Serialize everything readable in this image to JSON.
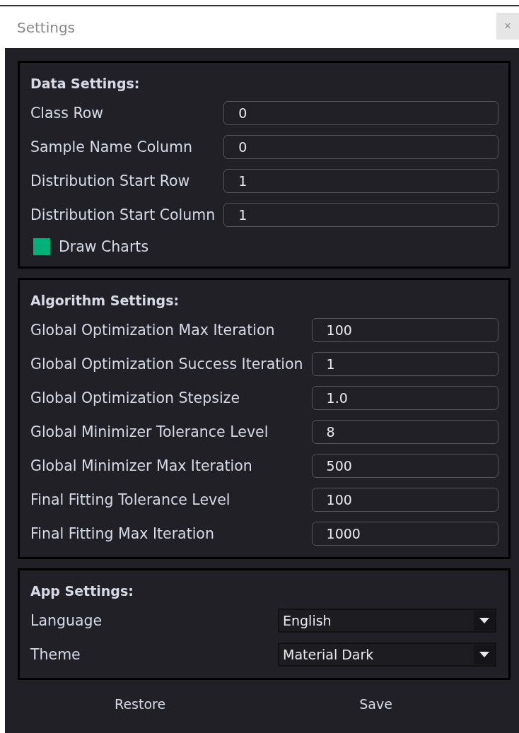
{
  "window": {
    "title": "Settings",
    "close": "×"
  },
  "sections": [
    {
      "title": "Data Settings:",
      "kind": "fields",
      "rows": [
        {
          "kind": "input",
          "label": "Class Row",
          "value": "0"
        },
        {
          "kind": "input",
          "label": "Sample Name Column",
          "value": "0"
        },
        {
          "kind": "input",
          "label": "Distribution Start Row",
          "value": "1"
        },
        {
          "kind": "input",
          "label": "Distribution Start Column",
          "value": "1"
        },
        {
          "kind": "checkbox",
          "label": "Draw Charts",
          "checked": true
        }
      ]
    },
    {
      "title": "Algorithm Settings:",
      "kind": "fields",
      "rows": [
        {
          "kind": "input",
          "label": "Global Optimization Max Iteration",
          "value": "100"
        },
        {
          "kind": "input",
          "label": "Global Optimization Success Iteration",
          "value": "1"
        },
        {
          "kind": "input",
          "label": "Global Optimization Stepsize",
          "value": "1.0"
        },
        {
          "kind": "input",
          "label": "Global Minimizer Tolerance Level",
          "value": "8"
        },
        {
          "kind": "input",
          "label": "Global Minimizer Max Iteration",
          "value": "500"
        },
        {
          "kind": "input",
          "label": "Final Fitting Tolerance Level",
          "value": "100"
        },
        {
          "kind": "input",
          "label": "Final Fitting Max Iteration",
          "value": "1000"
        }
      ]
    },
    {
      "title": "App Settings:",
      "kind": "combos",
      "rows": [
        {
          "kind": "combo",
          "label": "Language",
          "value": "English"
        },
        {
          "kind": "combo",
          "label": "Theme",
          "value": "Material Dark"
        }
      ]
    }
  ],
  "buttons": [
    "Restore",
    "Save"
  ]
}
